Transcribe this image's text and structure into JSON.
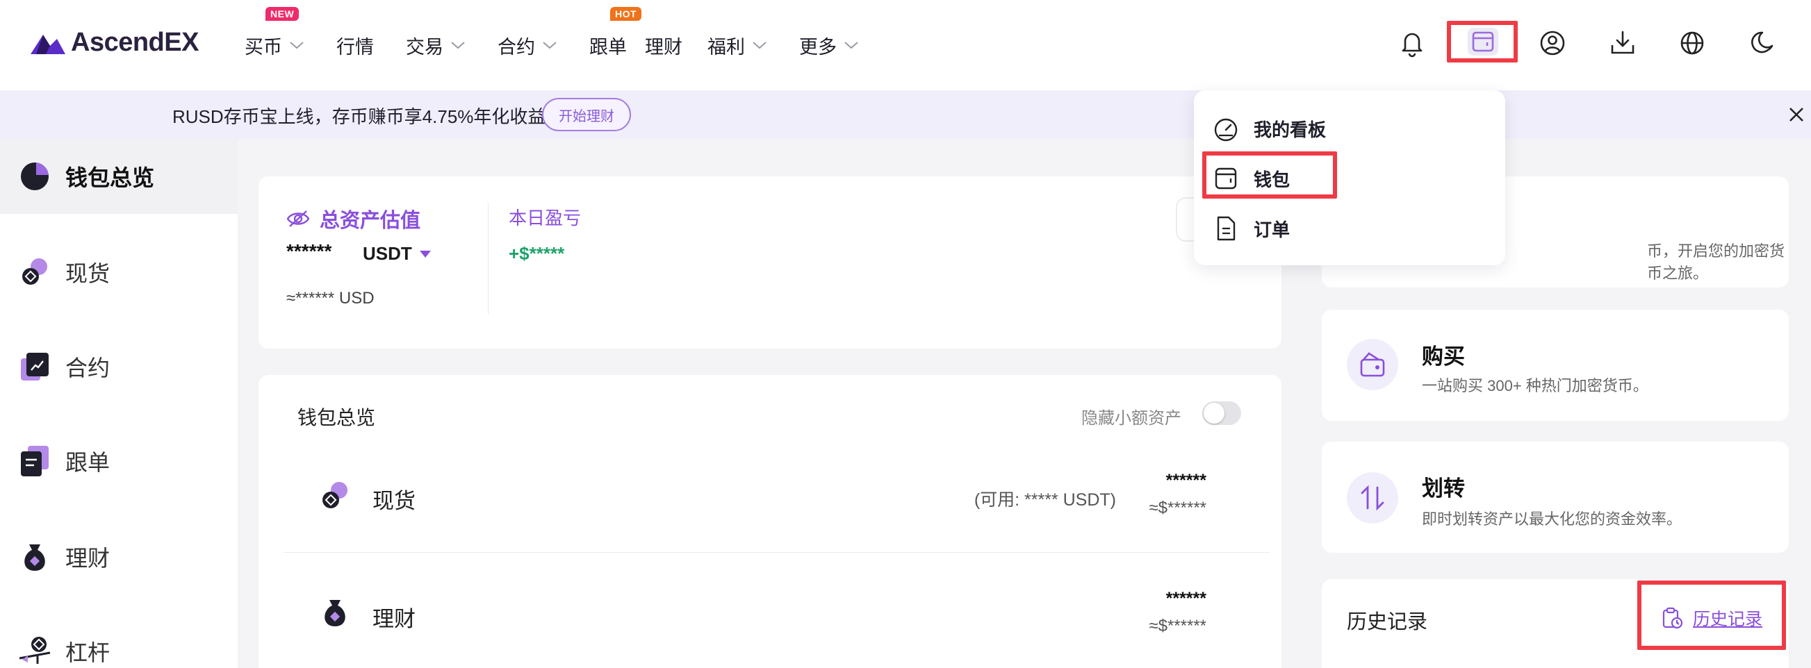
{
  "brand": {
    "name": "AscendEX"
  },
  "nav": {
    "items": [
      {
        "label": "买币",
        "has_chevron": true,
        "badge": "NEW"
      },
      {
        "label": "行情",
        "has_chevron": false
      },
      {
        "label": "交易",
        "has_chevron": true
      },
      {
        "label": "合约",
        "has_chevron": true
      },
      {
        "label": "跟单",
        "has_chevron": false,
        "badge": "HOT"
      },
      {
        "label": "理财",
        "has_chevron": false
      },
      {
        "label": "福利",
        "has_chevron": true
      },
      {
        "label": "更多",
        "has_chevron": true
      }
    ]
  },
  "header_icons": [
    "bell-icon",
    "wallet-icon",
    "user-icon",
    "download-icon",
    "globe-icon",
    "moon-icon"
  ],
  "banner": {
    "text": "RUSD存币宝上线，存币赚币享4.75%年化收益",
    "button": "开始理财"
  },
  "sidebar": {
    "items": [
      {
        "label": "钱包总览",
        "icon": "pie-chart-icon",
        "active": true
      },
      {
        "label": "现货",
        "icon": "spot-icon"
      },
      {
        "label": "合约",
        "icon": "futures-icon"
      },
      {
        "label": "跟单",
        "icon": "copy-trade-icon"
      },
      {
        "label": "理财",
        "icon": "earn-icon"
      },
      {
        "label": "杠杆",
        "icon": "margin-icon"
      }
    ]
  },
  "asset_summary": {
    "title": "总资产估值",
    "value": "******",
    "unit": "USDT",
    "usd": "≈****** USD",
    "pnl_title": "本日盈亏",
    "pnl_value": "+$*****"
  },
  "wallet_overview": {
    "title": "钱包总览",
    "hide_small_label": "隐藏小额资产",
    "rows": [
      {
        "label": "现货",
        "available": "(可用: ***** USDT)",
        "value": "******",
        "approx": "≈$******"
      },
      {
        "label": "理财",
        "available": "",
        "value": "******",
        "approx": "≈$******"
      }
    ]
  },
  "right_cards": [
    {
      "title": "",
      "desc": "币，开启您的加密货币之旅。"
    },
    {
      "title": "购买",
      "desc": "一站购买 300+ 种热门加密货币。",
      "icon": "wallet-buy-icon"
    },
    {
      "title": "划转",
      "desc": "即时划转资产以最大化您的资金效率。",
      "icon": "transfer-icon"
    }
  ],
  "history": {
    "title": "历史记录",
    "link": "历史记录"
  },
  "dropdown": {
    "items": [
      {
        "label": "我的看板",
        "icon": "dashboard-icon"
      },
      {
        "label": "钱包",
        "icon": "wallet-icon"
      },
      {
        "label": "订单",
        "icon": "document-icon"
      }
    ]
  },
  "colors": {
    "accent": "#8a4fdc",
    "highlight": "#ef3b45",
    "positive": "#1ea36a"
  }
}
